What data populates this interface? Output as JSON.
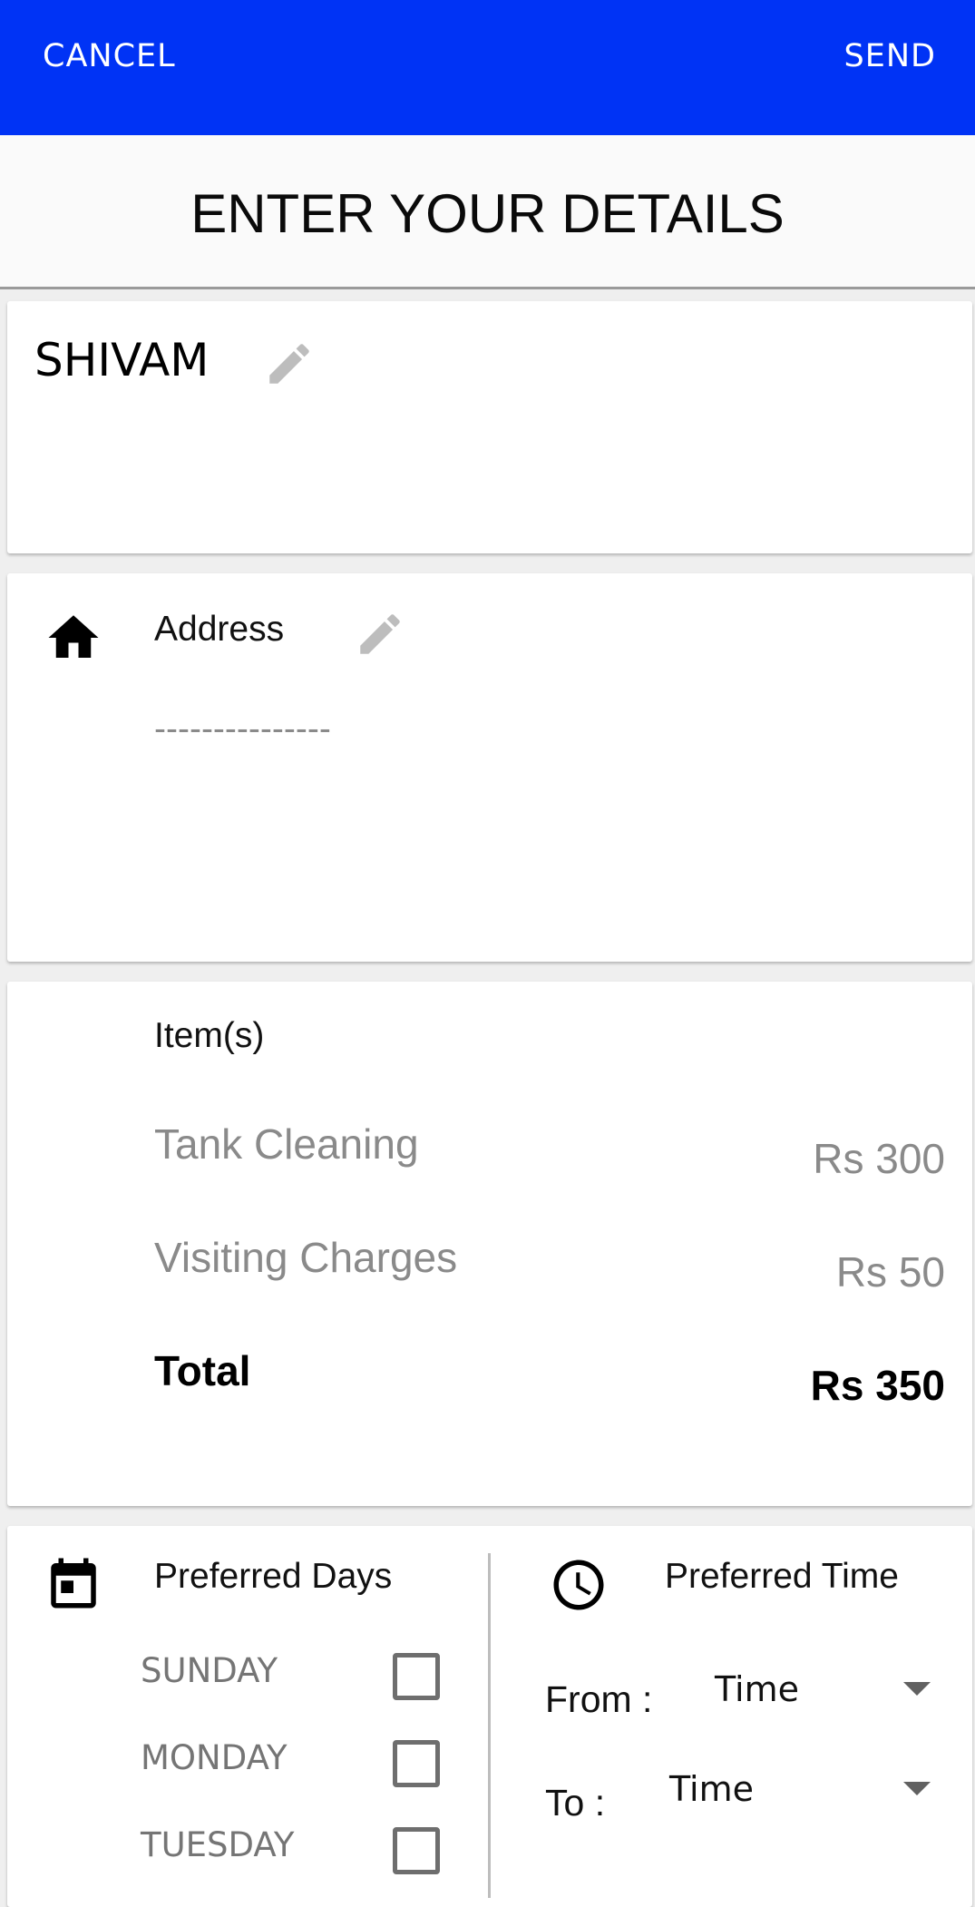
{
  "appbar": {
    "cancel_label": "CANCEL",
    "send_label": "SEND",
    "color": "#0033f5"
  },
  "page_title": "ENTER YOUR DETAILS",
  "name_card": {
    "name": "SHIVAM",
    "edit_icon": "pencil-icon"
  },
  "address_card": {
    "icon": "home-icon",
    "label": "Address",
    "value": "---------------",
    "edit_icon": "pencil-icon"
  },
  "items_card": {
    "label": "Item(s)",
    "items": [
      {
        "name": "Tank Cleaning",
        "price": "Rs 300"
      },
      {
        "name": "Visiting Charges",
        "price": "Rs 50"
      }
    ],
    "total": {
      "label": "Total",
      "price": "Rs 350"
    }
  },
  "preferences": {
    "days": {
      "icon": "calendar-icon",
      "label": "Preferred Days",
      "options": [
        {
          "label": "SUNDAY",
          "checked": false
        },
        {
          "label": "MONDAY",
          "checked": false
        },
        {
          "label": "TUESDAY",
          "checked": false
        }
      ]
    },
    "time": {
      "icon": "clock-icon",
      "label": "Preferred Time",
      "from_label": "From :",
      "from_value": "Time",
      "to_label": "To :",
      "to_value": "Time"
    }
  }
}
